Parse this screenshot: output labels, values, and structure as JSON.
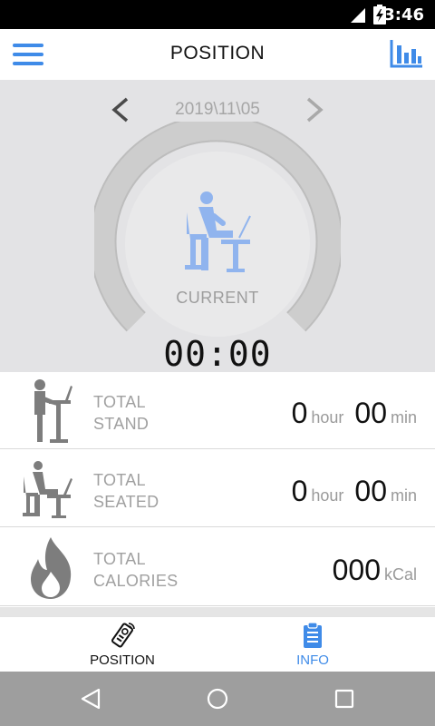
{
  "status_bar": {
    "time": "3:46"
  },
  "app_bar": {
    "title": "POSITION"
  },
  "date_nav": {
    "date": "2019\\11\\05",
    "prev_icon": "chevron-left",
    "next_icon": "chevron-right"
  },
  "gauge": {
    "label": "CURRENT",
    "timer": "00:00",
    "icon": "seated-desk-figure"
  },
  "stats": [
    {
      "label_line1": "TOTAL",
      "label_line2": "STAND",
      "hours": "0",
      "hour_unit": "hour",
      "minutes": "00",
      "min_unit": "min"
    },
    {
      "label_line1": "TOTAL",
      "label_line2": "SEATED",
      "hours": "0",
      "hour_unit": "hour",
      "minutes": "00",
      "min_unit": "min"
    },
    {
      "label_line1": "TOTAL",
      "label_line2": "CALORIES",
      "value": "000",
      "unit": "kCal"
    }
  ],
  "bottom_nav": {
    "tabs": [
      {
        "label": "POSITION",
        "icon": "remote-control-icon",
        "active": false
      },
      {
        "label": "INFO",
        "icon": "clipboard-icon",
        "active": true
      }
    ]
  },
  "colors": {
    "accent": "#3f8be8",
    "figure": "#90b4ee",
    "gauge_bg": "#e3e3e5",
    "label_gray": "#a0a0a0"
  }
}
